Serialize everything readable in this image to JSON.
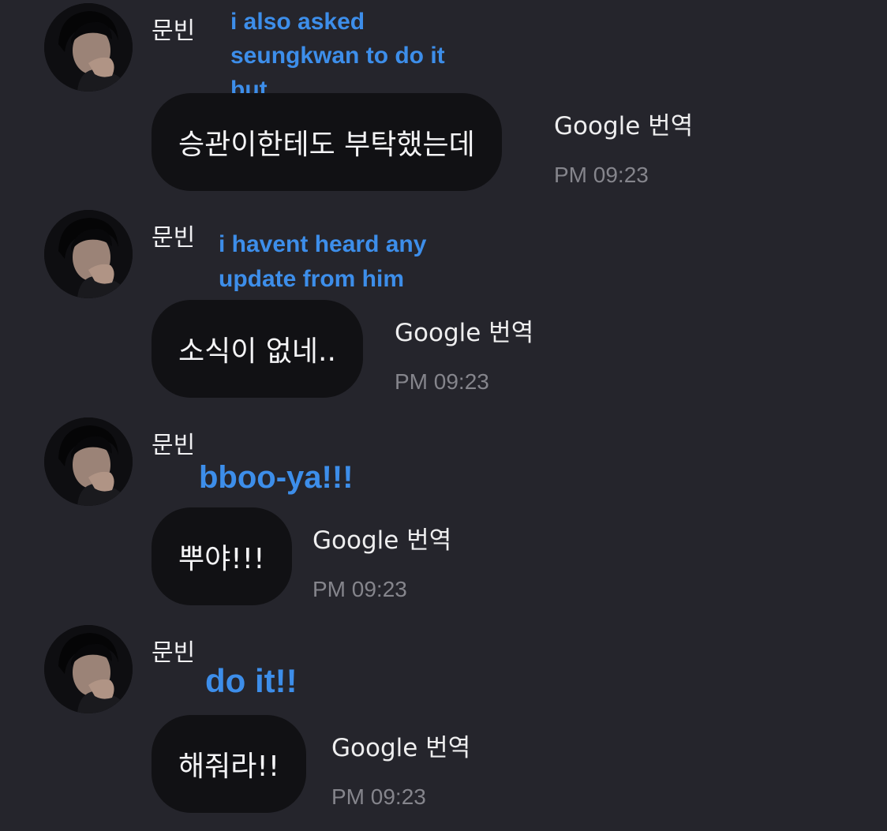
{
  "messages": [
    {
      "sender": "문빈",
      "avatar_icon": "profile-photo",
      "annotation": "i also asked seungkwan to do it but",
      "text": "승관이한테도 부탁했는데",
      "translate_label": "Google 번역",
      "time": "PM 09:23"
    },
    {
      "sender": "문빈",
      "avatar_icon": "profile-photo",
      "annotation": "i havent heard any update from him",
      "text": "소식이 없네..",
      "translate_label": "Google 번역",
      "time": "PM 09:23"
    },
    {
      "sender": "문빈",
      "avatar_icon": "profile-photo",
      "annotation": "bboo-ya!!!",
      "text": "뿌야!!!",
      "translate_label": "Google 번역",
      "time": "PM 09:23"
    },
    {
      "sender": "문빈",
      "avatar_icon": "profile-photo",
      "annotation": "do it!!",
      "text": "해줘라!!",
      "translate_label": "Google 번역",
      "time": "PM 09:23"
    }
  ],
  "colors": {
    "background": "#25252c",
    "bubble": "#111114",
    "annotation": "#3d8eea",
    "timestamp": "#85858c"
  }
}
